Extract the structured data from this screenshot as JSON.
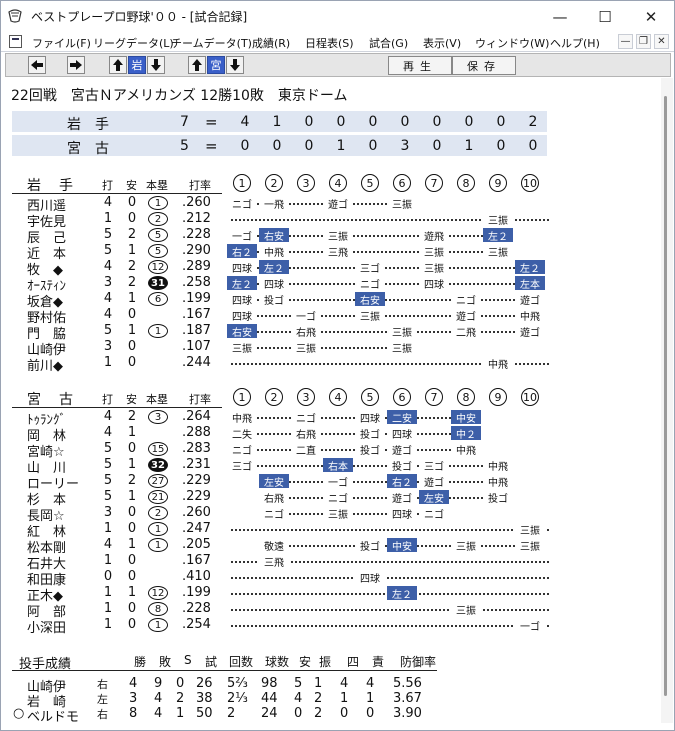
{
  "window": {
    "title": "ベストプレープロ野球'００ - [試合記録]",
    "controls": [
      "—",
      "☐",
      "✕"
    ]
  },
  "menu": [
    "ファイル(F)",
    "リーグデータ(L)",
    "チームデータ(T)",
    "成績(R)",
    "日程表(S)",
    "試合(G)",
    "表示(V)",
    "ウィンドウ(W)",
    "ヘルプ(H)"
  ],
  "mdi_controls": [
    "—",
    "❐",
    "✕"
  ],
  "toolbar": {
    "team1": "岩",
    "team2": "宮",
    "play_label": "再生",
    "save_label": "保存"
  },
  "game": {
    "title": "22回戦　宮古Ｎアメリカンズ 12勝10敗　東京ドーム"
  },
  "linescore": [
    {
      "team": "岩手",
      "total": "7",
      "innings": [
        "4",
        "1",
        "0",
        "0",
        "0",
        "0",
        "0",
        "0",
        "0",
        "2"
      ]
    },
    {
      "team": "宮古",
      "total": "5",
      "innings": [
        "0",
        "0",
        "0",
        "1",
        "0",
        "3",
        "0",
        "1",
        "0",
        "0"
      ]
    }
  ],
  "headers": {
    "ab": "打",
    "hits": "安",
    "hr": "本塁",
    "avg": "打率",
    "innings": [
      "1",
      "2",
      "3",
      "4",
      "5",
      "6",
      "7",
      "8",
      "9",
      "10"
    ]
  },
  "iwate": {
    "team": "岩手",
    "players": [
      {
        "name": "西川遥",
        "ab": "4",
        "h": "0",
        "hr": "1",
        "avg": ".260",
        "abs": [
          [
            "ニゴ",
            0
          ],
          [
            "一飛",
            0
          ],
          null,
          [
            "遊ゴ",
            0
          ],
          null,
          [
            "三振",
            0
          ],
          null,
          null,
          null,
          null
        ]
      },
      {
        "name": "宇佐見",
        "ab": "1",
        "h": "0",
        "hr": "2",
        "avg": ".212",
        "abs": [
          null,
          null,
          null,
          null,
          null,
          null,
          null,
          null,
          [
            "三振",
            0
          ],
          null
        ]
      },
      {
        "name": "辰　己",
        "ab": "5",
        "h": "2",
        "hr": "5",
        "avg": ".228",
        "abs": [
          [
            "一ゴ",
            0
          ],
          [
            "右安",
            1
          ],
          null,
          [
            "三振",
            0
          ],
          null,
          null,
          [
            "遊飛",
            0
          ],
          null,
          [
            "左２",
            1
          ],
          null
        ]
      },
      {
        "name": "近　本",
        "ab": "5",
        "h": "1",
        "hr": "5",
        "avg": ".290",
        "abs": [
          [
            "右２",
            1
          ],
          [
            "中飛",
            0
          ],
          null,
          [
            "三飛",
            0
          ],
          null,
          null,
          [
            "三振",
            0
          ],
          null,
          [
            "三振",
            0
          ],
          null
        ]
      },
      {
        "name": "牧　◆",
        "ab": "4",
        "h": "2",
        "hr": "12",
        "avg": ".289",
        "abs": [
          [
            "四球",
            0
          ],
          [
            "左２",
            1
          ],
          null,
          null,
          [
            "三ゴ",
            0
          ],
          null,
          [
            "三振",
            0
          ],
          null,
          null,
          [
            "左２",
            1
          ]
        ]
      },
      {
        "name": "ｵｰｽﾃｨﾝ",
        "ab": "3",
        "h": "2",
        "hr": "31",
        "hrdark": true,
        "avg": ".258",
        "abs": [
          [
            "左２",
            1
          ],
          [
            "四球",
            0
          ],
          null,
          null,
          [
            "ニゴ",
            0
          ],
          null,
          [
            "四球",
            0
          ],
          null,
          null,
          [
            "左本",
            1
          ]
        ]
      },
      {
        "name": "坂倉◆",
        "ab": "4",
        "h": "1",
        "hr": "6",
        "avg": ".199",
        "abs": [
          [
            "四球",
            0
          ],
          [
            "投ゴ",
            0
          ],
          null,
          null,
          [
            "右安",
            1
          ],
          null,
          null,
          [
            "ニゴ",
            0
          ],
          null,
          [
            "遊ゴ",
            0
          ]
        ]
      },
      {
        "name": "野村佑",
        "ab": "4",
        "h": "0",
        "hr": "",
        "avg": ".167",
        "abs": [
          [
            "四球",
            0
          ],
          null,
          [
            "一ゴ",
            0
          ],
          null,
          [
            "三振",
            0
          ],
          null,
          null,
          [
            "遊ゴ",
            0
          ],
          null,
          [
            "中飛",
            0
          ]
        ]
      },
      {
        "name": "門　脇",
        "ab": "5",
        "h": "1",
        "hr": "1",
        "avg": ".187",
        "abs": [
          [
            "右安",
            1
          ],
          null,
          [
            "右飛",
            0
          ],
          null,
          null,
          [
            "三振",
            0
          ],
          null,
          [
            "二飛",
            0
          ],
          null,
          [
            "遊ゴ",
            0
          ]
        ]
      },
      {
        "name": "山崎伊",
        "ab": "3",
        "h": "0",
        "hr": "",
        "avg": ".107",
        "abs": [
          [
            "三振",
            0
          ],
          null,
          [
            "三振",
            0
          ],
          null,
          null,
          [
            "三振",
            0
          ],
          null,
          null,
          null,
          null
        ]
      },
      {
        "name": "前川◆",
        "ab": "1",
        "h": "0",
        "hr": "",
        "avg": ".244",
        "abs": [
          null,
          null,
          null,
          null,
          null,
          null,
          null,
          null,
          [
            "中飛",
            0
          ],
          null
        ]
      }
    ]
  },
  "miyako": {
    "team": "宮古",
    "players": [
      {
        "name": "ﾄｩﾗﾝｸﾞ",
        "ab": "4",
        "h": "2",
        "hr": "3",
        "avg": ".264",
        "abs": [
          [
            "中飛",
            0
          ],
          null,
          [
            "ニゴ",
            0
          ],
          null,
          [
            "四球",
            0
          ],
          [
            "二安",
            1
          ],
          null,
          [
            "中安",
            1
          ],
          null,
          null
        ]
      },
      {
        "name": "岡　林",
        "ab": "4",
        "h": "1",
        "hr": "",
        "avg": ".288",
        "abs": [
          [
            "二失",
            0
          ],
          null,
          [
            "右飛",
            0
          ],
          null,
          [
            "投ゴ",
            0
          ],
          [
            "四球",
            0
          ],
          null,
          [
            "中２",
            1
          ],
          null,
          null
        ]
      },
      {
        "name": "宮崎☆",
        "ab": "5",
        "h": "0",
        "hr": "15",
        "avg": ".283",
        "abs": [
          [
            "ニゴ",
            0
          ],
          null,
          [
            "二直",
            0
          ],
          null,
          [
            "投ゴ",
            0
          ],
          [
            "遊ゴ",
            0
          ],
          null,
          [
            "中飛",
            0
          ],
          null,
          null
        ]
      },
      {
        "name": "山　川",
        "ab": "5",
        "h": "1",
        "hr": "32",
        "hrdark": true,
        "avg": ".231",
        "abs": [
          [
            "三ゴ",
            0
          ],
          null,
          null,
          [
            "右本",
            1
          ],
          null,
          [
            "投ゴ",
            0
          ],
          [
            "三ゴ",
            0
          ],
          null,
          [
            "中飛",
            0
          ],
          null
        ]
      },
      {
        "name": "ローリー",
        "ab": "5",
        "h": "2",
        "hr": "27",
        "avg": ".229",
        "abs": [
          null,
          [
            "左安",
            1
          ],
          null,
          [
            "一ゴ",
            0
          ],
          null,
          [
            "右２",
            1
          ],
          [
            "遊ゴ",
            0
          ],
          null,
          [
            "中飛",
            0
          ],
          null
        ]
      },
      {
        "name": "杉　本",
        "ab": "5",
        "h": "1",
        "hr": "21",
        "avg": ".229",
        "abs": [
          null,
          [
            "右飛",
            0
          ],
          null,
          [
            "ニゴ",
            0
          ],
          null,
          [
            "遊ゴ",
            0
          ],
          [
            "左安",
            1
          ],
          null,
          [
            "投ゴ",
            0
          ],
          null
        ]
      },
      {
        "name": "長岡☆",
        "ab": "3",
        "h": "0",
        "hr": "2",
        "avg": ".260",
        "abs": [
          null,
          [
            "ニゴ",
            0
          ],
          null,
          [
            "三振",
            0
          ],
          null,
          [
            "四球",
            0
          ],
          [
            "ニゴ",
            0
          ],
          null,
          null,
          null
        ]
      },
      {
        "name": "紅　林",
        "ab": "1",
        "h": "0",
        "hr": "1",
        "avg": ".247",
        "abs": [
          null,
          null,
          null,
          null,
          null,
          null,
          null,
          null,
          null,
          [
            "三振",
            0
          ]
        ]
      },
      {
        "name": "松本剛",
        "ab": "4",
        "h": "1",
        "hr": "1",
        "avg": ".205",
        "abs": [
          null,
          [
            "敬遠",
            0
          ],
          null,
          null,
          [
            "投ゴ",
            0
          ],
          [
            "中安",
            1
          ],
          null,
          [
            "三振",
            0
          ],
          null,
          [
            "三振",
            0
          ]
        ]
      },
      {
        "name": "石井大",
        "ab": "1",
        "h": "0",
        "hr": "",
        "avg": ".167",
        "abs": [
          null,
          [
            "三飛",
            0
          ],
          null,
          null,
          null,
          null,
          null,
          null,
          null,
          null
        ]
      },
      {
        "name": "和田康",
        "ab": "0",
        "h": "0",
        "hr": "",
        "avg": ".410",
        "abs": [
          null,
          null,
          null,
          null,
          [
            "四球",
            0
          ],
          null,
          null,
          null,
          null,
          null
        ]
      },
      {
        "name": "正木◆",
        "ab": "1",
        "h": "1",
        "hr": "12",
        "avg": ".199",
        "abs": [
          null,
          null,
          null,
          null,
          null,
          [
            "左２",
            1
          ],
          null,
          null,
          null,
          null
        ]
      },
      {
        "name": "阿　部",
        "ab": "1",
        "h": "0",
        "hr": "8",
        "avg": ".228",
        "abs": [
          null,
          null,
          null,
          null,
          null,
          null,
          null,
          [
            "三振",
            0
          ],
          null,
          null
        ]
      },
      {
        "name": "小深田",
        "ab": "1",
        "h": "0",
        "hr": "1",
        "avg": ".254",
        "abs": [
          null,
          null,
          null,
          null,
          null,
          null,
          null,
          null,
          null,
          [
            "一ゴ",
            0
          ]
        ]
      }
    ]
  },
  "pitching": {
    "title": "投手成績",
    "headers": [
      "勝",
      "敗",
      "S",
      "試",
      "回数",
      "球数",
      "安",
      "振",
      "四",
      "責",
      "防御率"
    ],
    "rows": [
      {
        "mark": "",
        "name": "山崎伊",
        "hand": "右",
        "w": "4",
        "l": "9",
        "s": "0",
        "g": "26",
        "ip": "5⅔",
        "np": "98",
        "h": "5",
        "so": "1",
        "bb": "4",
        "er": "4",
        "era": "5.56"
      },
      {
        "mark": "",
        "name": "岩　崎",
        "hand": "左",
        "w": "3",
        "l": "4",
        "s": "2",
        "g": "38",
        "ip": "2⅓",
        "np": "44",
        "h": "4",
        "so": "2",
        "bb": "1",
        "er": "1",
        "era": "3.67"
      },
      {
        "mark": "○",
        "name": "ベルドモ",
        "hand": "右",
        "w": "8",
        "l": "4",
        "s": "1",
        "g": "50",
        "ip": "2",
        "np": "24",
        "h": "0",
        "so": "2",
        "bb": "0",
        "er": "0",
        "era": "3.90"
      }
    ]
  }
}
